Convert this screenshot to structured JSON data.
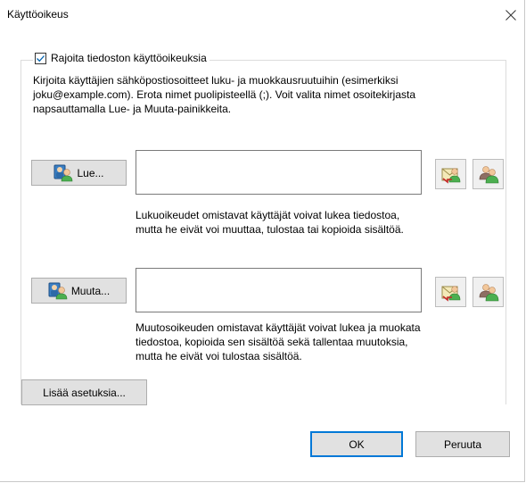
{
  "window": {
    "title": "Käyttöoikeus",
    "close_icon": "close-icon"
  },
  "restrict": {
    "checked": true,
    "label": "Rajoita tiedoston käyttöoikeuksia"
  },
  "instructions": [
    "Kirjoita käyttäjien sähköpostiosoitteet luku- ja muokkausruutuihin (esimerkiksi",
    "joku@example.com). Erota nimet puolipisteellä (;). Voit valita nimet osoitekirjasta",
    "napsauttamalla Lue- ja Muuta-painikkeita."
  ],
  "read": {
    "button_label": "Lue...",
    "value": "",
    "description": [
      "Lukuoikeudet omistavat käyttäjät voivat lukea tiedostoa,",
      "mutta he eivät voi muuttaa, tulostaa tai kopioida sisältöä."
    ]
  },
  "change": {
    "button_label": "Muuta...",
    "value": "",
    "description": [
      "Muutosoikeuden omistavat käyttäjät voivat lukea ja muokata",
      "tiedostoa, kopioida sen sisältöä sekä tallentaa muutoksia,",
      "mutta he eivät voi tulostaa sisältöä."
    ]
  },
  "more_settings_label": "Lisää asetuksia...",
  "footer": {
    "ok_label": "OK",
    "cancel_label": "Peruuta"
  },
  "colors": {
    "accent": "#0078d7",
    "button_face": "#e1e1e1",
    "field_border": "#7a7a7a"
  }
}
